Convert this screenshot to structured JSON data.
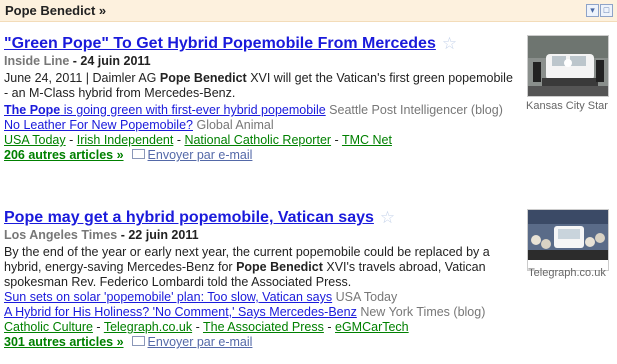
{
  "header": {
    "title": "Pope Benedict »"
  },
  "stories": [
    {
      "headline": "\"Green Pope\" To Get Hybrid Popemobile From Mercedes",
      "source": "Inside Line",
      "date": "24 juin 2011",
      "snippet_pre": "June 24, 2011 | Daimler AG ",
      "snippet_bold": "Pope Benedict",
      "snippet_post": " XVI will get the Vatican's first green popemobile - an M-Class hybrid from Mercedes-Benz.",
      "related": [
        {
          "title_bold": "The Pope",
          "title_rest": " is going green with first-ever hybrid popemobile",
          "source": "Seattle Post Intelligencer (blog)"
        },
        {
          "title": "No Leather For New Popemobile?",
          "source": "Global Animal"
        }
      ],
      "more_sources": [
        "USA Today",
        "Irish Independent",
        "National Catholic Reporter",
        "TMC Net"
      ],
      "articles_link": "206 autres articles »",
      "email_label": "Envoyer par e-mail",
      "thumb_caption": "Kansas City Star"
    },
    {
      "headline": "Pope may get a hybrid popemobile, Vatican says",
      "source": "Los Angeles Times",
      "date": "22 juin 2011",
      "snippet_pre": "By the end of the year or early next year, the current popemobile could be replaced by a hybrid, energy-saving Mercedes-Benz for ",
      "snippet_bold": "Pope Benedict",
      "snippet_post": " XVI's travels abroad, Vatican spokesman Rev. Federico Lombardi told the Associated Press.",
      "related": [
        {
          "title": "Sun sets on solar 'popemobile' plan: Too slow, Vatican says",
          "source": "USA Today"
        },
        {
          "title": "A Hybrid for His Holiness? 'No Comment,' Says Mercedes-Benz",
          "source": "New York Times (blog)"
        }
      ],
      "more_sources": [
        "Catholic Culture",
        "Telegraph.co.uk",
        "The Associated Press",
        "eGMCarTech"
      ],
      "articles_link": "301 autres articles »",
      "email_label": "Envoyer par e-mail",
      "thumb_caption": "Telegraph.co.uk"
    }
  ],
  "icons": {
    "star": "star-icon",
    "mail": "mail-icon",
    "edit": "edit-icon",
    "minimize": "minimize-icon"
  }
}
